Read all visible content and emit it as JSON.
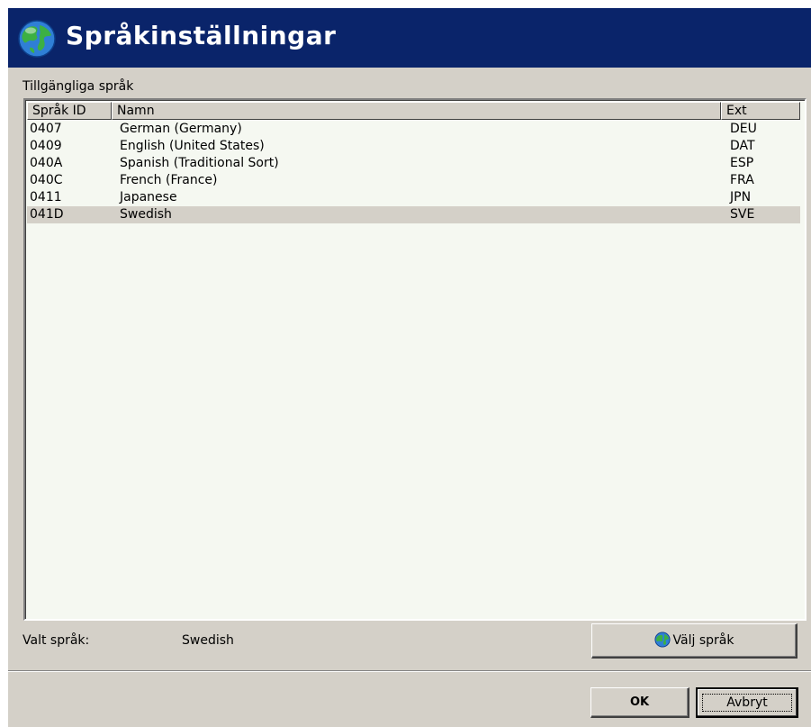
{
  "window": {
    "title": "Språkinställningar",
    "title_icon": "globe-icon",
    "title_bg": "#0a246a"
  },
  "list": {
    "label": "Tillgängliga språk",
    "columns": {
      "id": "Språk ID",
      "name": "Namn",
      "ext": "Ext"
    },
    "rows": [
      {
        "id": "0407",
        "name": "German (Germany)",
        "ext": "DEU"
      },
      {
        "id": "0409",
        "name": "English (United States)",
        "ext": "DAT"
      },
      {
        "id": "040A",
        "name": "Spanish (Traditional Sort)",
        "ext": "ESP"
      },
      {
        "id": "040C",
        "name": "French (France)",
        "ext": "FRA"
      },
      {
        "id": "0411",
        "name": "Japanese",
        "ext": "JPN"
      },
      {
        "id": "041D",
        "name": "Swedish",
        "ext": "SVE"
      }
    ],
    "selected_index": 5
  },
  "selection": {
    "label": "Valt språk:",
    "value": "Swedish"
  },
  "buttons": {
    "select_language": "Välj språk",
    "select_language_icon": "globe-icon",
    "ok": "OK",
    "cancel": "Avbryt"
  }
}
